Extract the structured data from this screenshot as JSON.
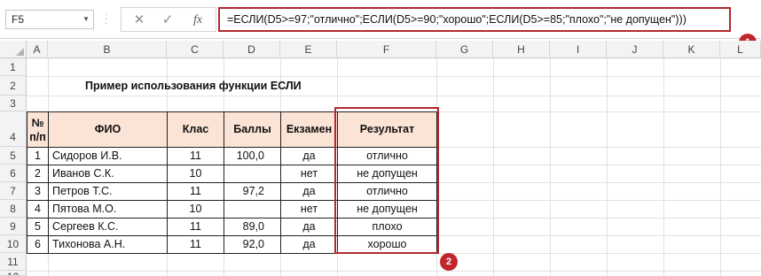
{
  "formula_bar": {
    "name_box": "F5",
    "cancel_icon": "✕",
    "enter_icon": "✓",
    "fx_label": "fx",
    "formula": "=ЕСЛИ(D5>=97;\"отлично\";ЕСЛИ(D5>=90;\"хорошо\";ЕСЛИ(D5>=85;\"плохо\";\"не допущен\")))"
  },
  "badges": [
    "1",
    "2"
  ],
  "columns": [
    "A",
    "B",
    "C",
    "D",
    "E",
    "F",
    "G",
    "H",
    "I",
    "J",
    "K",
    "L"
  ],
  "rows": [
    "1",
    "2",
    "3",
    "4",
    "5",
    "6",
    "7",
    "8",
    "9",
    "10",
    "11",
    "12"
  ],
  "title": "Пример использования функции ЕСЛИ",
  "table": {
    "headers": {
      "num_line1": "№",
      "num_line2": "п/п",
      "name": "ФИО",
      "class": "Клас",
      "score": "Баллы",
      "exam": "Екзамен",
      "result": "Результат"
    },
    "rows": [
      {
        "num": "1",
        "name": "Сидоров И.В.",
        "class": "11",
        "score": "100,0",
        "exam": "да",
        "result": "отлично"
      },
      {
        "num": "2",
        "name": "Иванов С.К.",
        "class": "10",
        "score": "",
        "exam": "нет",
        "result": "не допущен"
      },
      {
        "num": "3",
        "name": "Петров Т.С.",
        "class": "11",
        "score": "97,2",
        "exam": "да",
        "result": "отлично"
      },
      {
        "num": "4",
        "name": "Пятова М.О.",
        "class": "10",
        "score": "",
        "exam": "нет",
        "result": "не допущен"
      },
      {
        "num": "5",
        "name": "Сергеев К.С.",
        "class": "11",
        "score": "89,0",
        "exam": "да",
        "result": "плохо"
      },
      {
        "num": "6",
        "name": "Тихонова А.Н.",
        "class": "11",
        "score": "92,0",
        "exam": "да",
        "result": "хорошо"
      }
    ]
  },
  "colors": {
    "header_fill": "#fbe3d6",
    "highlight": "#b3292e",
    "badge": "#c0272d"
  }
}
